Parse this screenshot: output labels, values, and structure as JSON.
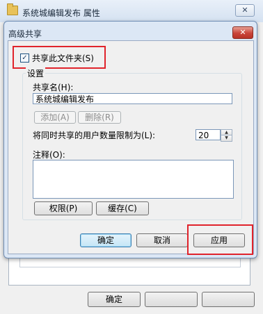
{
  "outer_window": {
    "title": "系统城编辑发布 属性",
    "close_label": "✕",
    "ok_label": "确定"
  },
  "dialog": {
    "title": "高级共享",
    "close_label": "✕",
    "share_checkbox": {
      "label": "共享此文件夹(S)",
      "checked": true,
      "check_glyph": "✓"
    },
    "settings": {
      "group_label": "设置",
      "share_name_label": "共享名(H):",
      "share_name_value": "系统城编辑发布",
      "add_label": "添加(A)",
      "remove_label": "删除(R)",
      "user_limit_label": "将同时共享的用户数量限制为(L):",
      "user_limit_value": "20",
      "comment_label": "注释(O):",
      "comment_value": "",
      "permissions_label": "权限(P)",
      "caching_label": "缓存(C)"
    },
    "buttons": {
      "ok": "确定",
      "cancel": "取消",
      "apply": "应用"
    }
  },
  "highlight_color": "#e0232b"
}
